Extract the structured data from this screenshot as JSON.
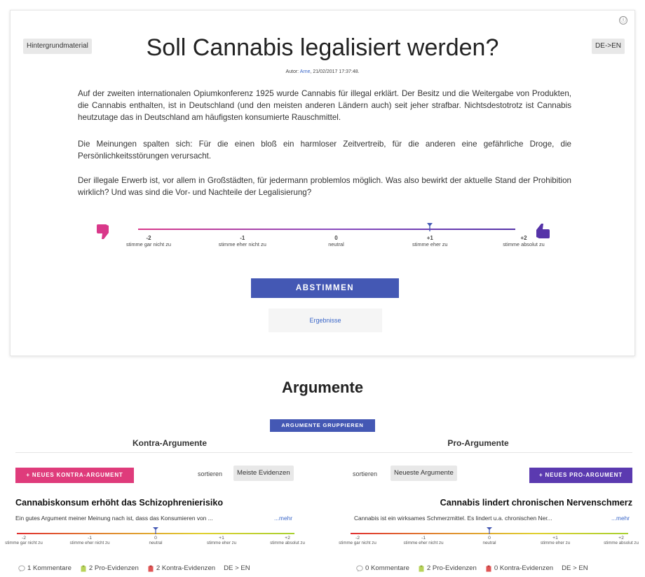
{
  "card": {
    "background_button": "Hintergrundmaterial",
    "lang_button": "DE->EN",
    "info_icon": "ⓘ",
    "title": "Soll Cannabis legalisiert werden?",
    "author_prefix": "Autor: ",
    "author_name": "Arne",
    "author_suffix": ", 21/02/2017 17:37:48.",
    "paragraphs": [
      "Auf der zweiten internationalen Opiumkonferenz 1925 wurde Cannabis für illegal erklärt. Der Besitz und die Weitergabe von Produkten, die Cannabis enthalten, ist in Deutschland (und den meisten anderen Ländern auch) seit jeher strafbar. Nichtsdestotrotz ist Cannabis heutzutage das in Deutschland am häufigsten konsumierte Rauschmittel.",
      "Die Meinungen spalten sich: Für die einen bloß ein harmloser Zeitvertreib, für die anderen eine gefährliche Droge, die Persönlichkeitsstörungen verursacht.",
      "Der illegale Erwerb ist, vor allem in Großstädten, für jedermann problemlos möglich. Was also bewirkt der aktuelle Stand der Prohibition wirklich? Und was sind die Vor- und Nachteile der Legalisierung?"
    ],
    "scale": {
      "selected_value": 1,
      "ticks": [
        {
          "num": "-2",
          "label": "stimme gar nicht zu"
        },
        {
          "num": "-1",
          "label": "stimme eher nicht zu"
        },
        {
          "num": "0",
          "label": "neutral"
        },
        {
          "num": "+1",
          "label": "stimme eher zu"
        },
        {
          "num": "+2",
          "label": "stimme absolut zu"
        }
      ],
      "down_color": "#d9388a",
      "up_color": "#5533a8"
    },
    "vote_button": "ABSTIMMEN",
    "results_button": "Ergebnisse"
  },
  "arguments": {
    "title": "Argumente",
    "group_button": "ARGUMENTE GRUPPIEREN",
    "kontra": {
      "heading": "Kontra-Argumente",
      "new_button": "+ NEUES KONTRA-ARGUMENT",
      "sort_label": "sortieren",
      "sort_value": "Meiste Evidenzen",
      "arg_title": "Cannabiskonsum erhöht das Schizophrenierisiko",
      "arg_text": "Ein gutes Argument meiner Meinung nach ist, dass das Konsumieren von ...",
      "more": "...mehr",
      "selected_value": 0,
      "comments": "1 Kommentare",
      "pro_evidence": "2 Pro-Evidenzen",
      "contra_evidence": "2 Kontra-Evidenzen",
      "lang": "DE > EN"
    },
    "pro": {
      "heading": "Pro-Argumente",
      "new_button": "+ NEUES PRO-ARGUMENT",
      "sort_label": "sortieren",
      "sort_value": "Neueste Argumente",
      "arg_title": "Cannabis lindert chronischen Nervenschmerz",
      "arg_text": "Cannabis ist ein wirksames Schmerzmittel. Es lindert u.a. chronischen Ner...",
      "more": "...mehr",
      "selected_value": 0,
      "comments": "0 Kommentare",
      "pro_evidence": "2 Pro-Evidenzen",
      "contra_evidence": "0 Kontra-Evidenzen",
      "lang": "DE > EN"
    },
    "mini_ticks": [
      {
        "num": "-2",
        "label": "stimme gar nicht zu"
      },
      {
        "num": "-1",
        "label": "stimme eher nicht zu"
      },
      {
        "num": "0",
        "label": "neutral"
      },
      {
        "num": "+1",
        "label": "stimme eher zu"
      },
      {
        "num": "+2",
        "label": "stimme absolut zu"
      }
    ]
  }
}
